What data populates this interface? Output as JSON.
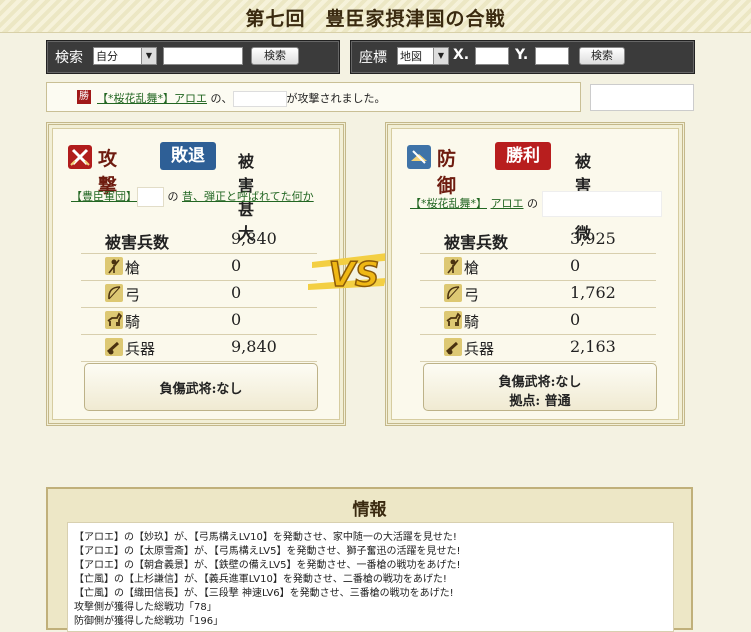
{
  "page": {
    "title": "第七回　豊臣家摂津国の合戦"
  },
  "search": {
    "label": "検索",
    "select_value": "自分",
    "button": "検索"
  },
  "coords": {
    "label": "座標",
    "select_value": "地図",
    "x_label": "X.",
    "y_label": "Y.",
    "button": "検索"
  },
  "notice": {
    "icon": "勝",
    "alliance": "【*桜花乱舞*】",
    "player": "アロエ",
    "prefix": " の、",
    "suffix": "が攻撃されました。"
  },
  "attack": {
    "word": "攻撃",
    "result": "敗退",
    "damage": "被害甚大",
    "alliance": "【豊臣軍団】",
    "mid": "の",
    "target": "昔、弾正と呼ばれてた何か",
    "stats": [
      {
        "name": "被害兵数",
        "value": "9,840",
        "icon": ""
      },
      {
        "name": "槍",
        "value": "0",
        "icon": "spear-icon"
      },
      {
        "name": "弓",
        "value": "0",
        "icon": "bow-icon"
      },
      {
        "name": "騎",
        "value": "0",
        "icon": "horse-icon"
      },
      {
        "name": "兵器",
        "value": "9,840",
        "icon": "siege-icon"
      }
    ],
    "injury": "負傷武将:なし",
    "base": ""
  },
  "defense": {
    "word": "防御",
    "result": "勝利",
    "damage": "被害軽微",
    "alliance": "【*桜花乱舞*】",
    "player": "アロエ",
    "mid": "の",
    "stats": [
      {
        "name": "被害兵数",
        "value": "3,925",
        "icon": ""
      },
      {
        "name": "槍",
        "value": "0",
        "icon": "spear-icon"
      },
      {
        "name": "弓",
        "value": "1,762",
        "icon": "bow-icon"
      },
      {
        "name": "騎",
        "value": "0",
        "icon": "horse-icon"
      },
      {
        "name": "兵器",
        "value": "2,163",
        "icon": "siege-icon"
      }
    ],
    "injury": "負傷武将:なし",
    "base": "拠点: 普通"
  },
  "vs": "VS",
  "info": {
    "title": "情報",
    "lines": [
      "【アロエ】の【妙玖】が、【弓馬構えLV10】を発動させ、家中随一の大活躍を見せた!",
      "【アロエ】の【太原雪斎】が、【弓馬構えLV5】を発動させ、獅子奮迅の活躍を見せた!",
      "【アロエ】の【朝倉義景】が、【鉄壁の備えLV5】を発動させ、一番槍の戦功をあげた!",
      "【亡風】の【上杉謙信】が、【義兵進軍LV10】を発動させ、二番槍の戦功をあげた!",
      "【亡風】の【織田信長】が、【三段撃 神速LV6】を発動させ、三番槍の戦功をあげた!",
      "攻撃側が獲得した総戦功「78」",
      "防御側が獲得した総戦功「196」"
    ]
  },
  "colors": {
    "attack_badge": "#2e5f96",
    "defense_badge": "#b81e1e",
    "vs": "#f0b814"
  }
}
